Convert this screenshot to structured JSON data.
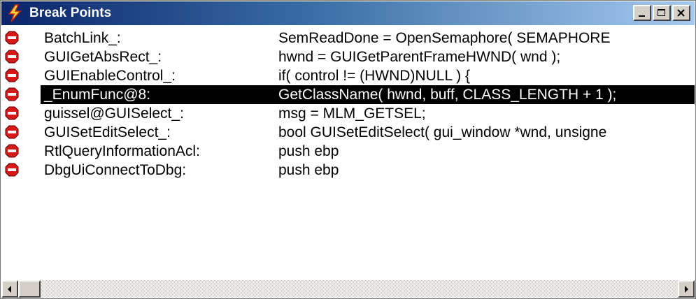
{
  "window": {
    "title": "Break Points",
    "icon": "lightning-bolt-icon"
  },
  "breakpoints": [
    {
      "name": "BatchLink_:",
      "code": "SemReadDone = OpenSemaphore( SEMAPHORE",
      "icon": "stop-sign-icon",
      "selected": false
    },
    {
      "name": "GUIGetAbsRect_:",
      "code": "hwnd = GUIGetParentFrameHWND( wnd );",
      "icon": "stop-sign-icon",
      "selected": false
    },
    {
      "name": "GUIEnableControl_:",
      "code": "if( control != (HWND)NULL ) {",
      "icon": "stop-sign-icon",
      "selected": false
    },
    {
      "name": "_EnumFunc@8:",
      "code": "GetClassName( hwnd, buff, CLASS_LENGTH + 1 );",
      "icon": "stop-sign-icon",
      "selected": true
    },
    {
      "name": "guissel@GUISelect_:",
      "code": "msg = MLM_GETSEL;",
      "icon": "stop-sign-icon",
      "selected": false
    },
    {
      "name": "GUISetEditSelect_:",
      "code": "bool GUISetEditSelect( gui_window *wnd, unsigne",
      "icon": "stop-sign-icon",
      "selected": false
    },
    {
      "name": "RtlQueryInformationAcl:",
      "code": "push ebp",
      "icon": "stop-sign-icon",
      "selected": false
    },
    {
      "name": "DbgUiConnectToDbg:",
      "code": "push ebp",
      "icon": "stop-sign-icon",
      "selected": false
    }
  ],
  "colors": {
    "titlebar_start": "#0a246a",
    "titlebar_end": "#a6caf0",
    "selection": "#000000",
    "breakpoint_red": "#d81818"
  }
}
